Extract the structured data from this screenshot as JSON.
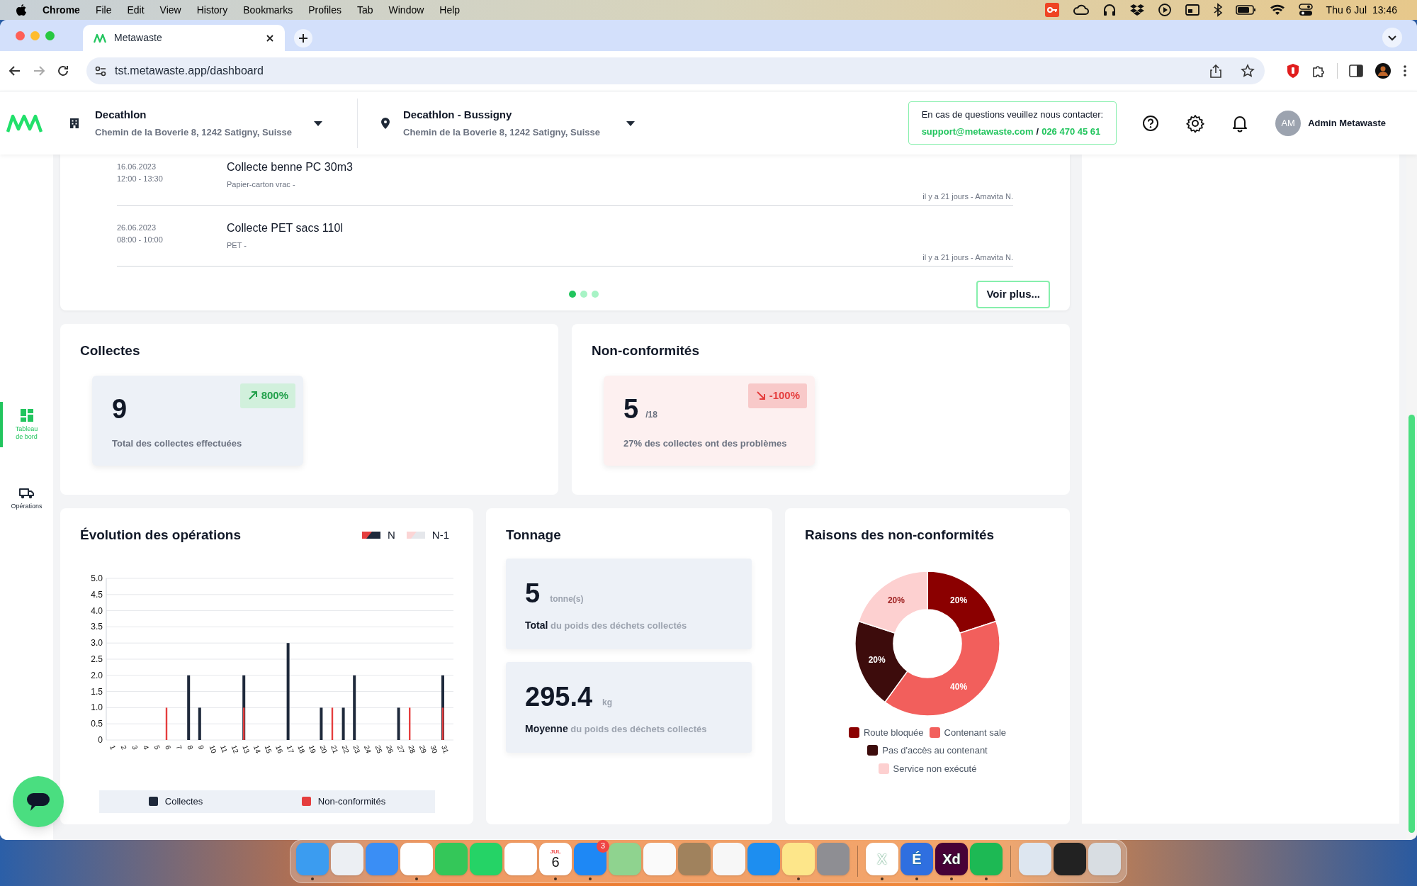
{
  "menu_bar": {
    "app": "Chrome",
    "items": [
      "File",
      "Edit",
      "View",
      "History",
      "Bookmarks",
      "Profiles",
      "Tab",
      "Window",
      "Help"
    ],
    "clock": "Thu 6 Jul  13:46"
  },
  "browser": {
    "tab": {
      "title": "Metawaste"
    },
    "url": "tst.metawaste.app/dashboard"
  },
  "header": {
    "company": {
      "name": "Decathlon",
      "address": "Chemin de la Boverie 8, 1242 Satigny, Suisse"
    },
    "site": {
      "name": "Decathlon - Bussigny",
      "address": "Chemin de la Boverie 8, 1242 Satigny, Suisse"
    },
    "contact": {
      "text": "En cas de questions veuillez nous contacter:",
      "email": "support@metawaste.com",
      "separator": "/",
      "phone": "026 470 45 61"
    },
    "user": {
      "initials": "AM",
      "name": "Admin Metawaste"
    }
  },
  "sidebar": [
    {
      "kind": "dashboard",
      "label": "Tableau de bord",
      "selected": true
    },
    {
      "kind": "truck",
      "label": "Opérations",
      "selected": false
    }
  ],
  "collections": [
    {
      "date": "16.06.2023",
      "time": "12:00 - 13:30",
      "title": "Collecte benne PC 30m3",
      "subtitle": "Papier-carton vrac -",
      "footer": "il y a 21 jours - Amavita N."
    },
    {
      "date": "26.06.2023",
      "time": "08:00 - 10:00",
      "title": "Collecte PET sacs 110l",
      "subtitle": "PET -",
      "footer": "il y a 21 jours - Amavita N."
    }
  ],
  "pagination": [
    {
      "selected": true
    },
    {
      "selected": false
    },
    {
      "selected": false
    }
  ],
  "more_button": "Voir plus...",
  "stats": [
    {
      "title": "Collectes",
      "value": "9",
      "caption": "Total des collectes effectuées",
      "trend": "800%",
      "kind": "up"
    },
    {
      "title": "Non-conformités",
      "value": "5",
      "unit": "/18",
      "caption": "27% des collectes ont des problèmes",
      "trend": "-100%",
      "kind": "down"
    }
  ],
  "evolution": {
    "title": "Évolution des opérations",
    "periods": [
      {
        "kind": "split",
        "label": "N"
      },
      {
        "kind": "light",
        "label": "N-1"
      }
    ],
    "chart_data": {
      "type": "bar",
      "grid": true,
      "categories": [
        "1",
        "2",
        "3",
        "4",
        "5",
        "6",
        "7",
        "8",
        "9",
        "10",
        "11",
        "12",
        "13",
        "14",
        "15",
        "16",
        "17",
        "18",
        "19",
        "20",
        "21",
        "22",
        "23",
        "24",
        "25",
        "26",
        "27",
        "28",
        "29",
        "30",
        "31"
      ],
      "ylim": [
        0,
        5
      ],
      "yticks": [
        {
          "value": 0,
          "label": "0"
        },
        {
          "value": 0.5,
          "label": "0.5"
        },
        {
          "value": 1,
          "label": "1.0"
        },
        {
          "value": 1.5,
          "label": "1.5"
        },
        {
          "value": 2,
          "label": "2.0"
        },
        {
          "value": 2.5,
          "label": "2.5"
        },
        {
          "value": 3,
          "label": "3.0"
        },
        {
          "value": 3.5,
          "label": "3.5"
        },
        {
          "value": 4,
          "label": "4.0"
        },
        {
          "value": 4.5,
          "label": "4.5"
        },
        {
          "value": 5,
          "label": "5.0"
        }
      ],
      "series": [
        {
          "name": "Collectes",
          "color": "#1e293b",
          "values": [
            null,
            null,
            null,
            null,
            null,
            null,
            null,
            2,
            1,
            null,
            null,
            null,
            2,
            null,
            null,
            null,
            3,
            null,
            null,
            1,
            null,
            1,
            2,
            null,
            null,
            null,
            1,
            null,
            null,
            null,
            2
          ]
        },
        {
          "name": "Non-conformités",
          "color": "#e53e3e",
          "values": [
            null,
            null,
            null,
            null,
            null,
            1,
            null,
            null,
            null,
            null,
            null,
            null,
            1,
            null,
            null,
            null,
            null,
            null,
            null,
            null,
            1,
            null,
            null,
            null,
            null,
            null,
            null,
            1,
            null,
            null,
            1
          ]
        }
      ]
    }
  },
  "tonnage": {
    "title": "Tonnage",
    "cards": [
      {
        "value": "5",
        "unit": "tonne(s)",
        "caption": "**Total** du poids des déchets collectés"
      },
      {
        "value": "295.4",
        "unit": "kg",
        "caption": "**Moyenne** du poids des déchets collectés"
      }
    ]
  },
  "reasons": {
    "title": "Raisons des non-conformités",
    "chart_data": {
      "type": "donut",
      "categories": [
        "Route bloquée",
        "Contenant sale",
        "Pas d'accès au contenant",
        "Service non exécuté"
      ],
      "values": [
        20,
        40,
        20,
        20
      ],
      "value_labels": [
        "20%",
        "40%",
        "20%",
        "20%"
      ]
    },
    "legend": [
      {
        "color": "#8b0000"
      },
      {
        "color": "#f25f5c"
      },
      {
        "color": "#3d0c0c"
      },
      {
        "color": "#fdd0d0"
      }
    ]
  },
  "dock": [
    {
      "apps": [
        {
          "color": "#3b9cf0",
          "running": true
        },
        {
          "color": "#eceff3",
          "running": false
        },
        {
          "color": "#3a8ef5",
          "running": false
        },
        {
          "color": "#ffffff",
          "running": true
        },
        {
          "color": "#34c759",
          "running": false
        },
        {
          "color": "#25d366",
          "running": false
        },
        {
          "color": "#ffffff",
          "running": false
        },
        {
          "color": "#ffffff",
          "running": true,
          "caption": "JUL",
          "text": "6"
        },
        {
          "color": "#1e88f5",
          "running": true,
          "badge": "3"
        },
        {
          "color": "#8fd38f",
          "running": false
        },
        {
          "color": "#fafafa",
          "running": false
        },
        {
          "color": "#a0825d",
          "running": false
        },
        {
          "color": "#f7f7f7",
          "running": false
        },
        {
          "color": "#1d8ef0",
          "running": false
        },
        {
          "color": "#fde68a",
          "running": true
        },
        {
          "color": "#8e8e93",
          "running": false
        }
      ]
    },
    {
      "apps": [
        {
          "color": "#ffffff",
          "running": true,
          "text": "X"
        },
        {
          "color": "#2f6fe0",
          "running": true,
          "text": "É"
        },
        {
          "color": "#470137",
          "running": true,
          "text": "Xd"
        },
        {
          "color": "#1db954",
          "running": true
        }
      ]
    },
    {
      "apps": [
        {
          "color": "#dde6f0",
          "running": false
        },
        {
          "color": "#222222",
          "running": false
        },
        {
          "color": "#d8dde2",
          "running": false
        }
      ]
    }
  ]
}
